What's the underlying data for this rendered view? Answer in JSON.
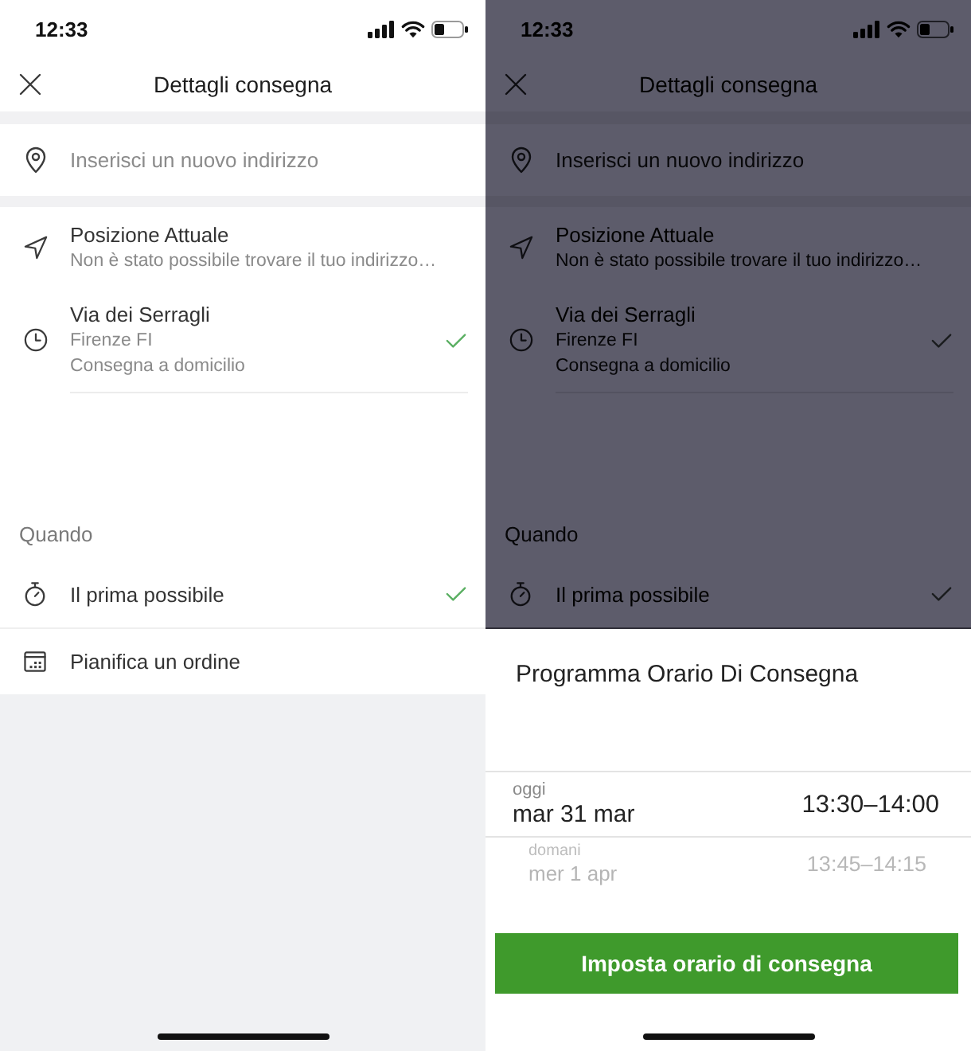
{
  "screens": [
    {
      "dimmed": false,
      "status_bar": {
        "time": "12:33"
      },
      "header": {
        "title": "Dettagli consegna"
      },
      "address_field": {
        "placeholder": "Inserisci un nuovo indirizzo"
      },
      "places": [
        {
          "kind": "current_location",
          "title": "Posizione Attuale",
          "lines": [
            "Non è stato possibile trovare il tuo indirizzo…"
          ],
          "selected": false
        },
        {
          "kind": "recent",
          "title": "Via dei Serragli",
          "lines": [
            "Firenze FI",
            "Consegna a domicilio"
          ],
          "selected": true
        }
      ],
      "when": {
        "label": "Quando",
        "options": [
          {
            "kind": "asap",
            "label": "Il prima possibile",
            "selected": true
          },
          {
            "kind": "schedule",
            "label": "Pianifica un ordine",
            "selected": false
          }
        ]
      }
    },
    {
      "dimmed": true,
      "status_bar": {
        "time": "12:33"
      },
      "header": {
        "title": "Dettagli consegna"
      },
      "address_field": {
        "placeholder": "Inserisci un nuovo indirizzo"
      },
      "places": [
        {
          "kind": "current_location",
          "title": "Posizione Attuale",
          "lines": [
            "Non è stato possibile trovare il tuo indirizzo…"
          ],
          "selected": false
        },
        {
          "kind": "recent",
          "title": "Via dei Serragli",
          "lines": [
            "Firenze FI",
            "Consegna a domicilio"
          ],
          "selected": true
        }
      ],
      "when": {
        "label": "Quando",
        "options": [
          {
            "kind": "asap",
            "label": "Il prima possibile",
            "selected": true
          }
        ]
      },
      "sheet": {
        "title": "Programma Orario Di Consegna",
        "slots": [
          {
            "day": "oggi",
            "date": "mar 31 mar",
            "time": "13:30–14:00",
            "selected": true
          },
          {
            "day": "domani",
            "date": "mer 1 apr",
            "time": "13:45–14:15",
            "selected": false
          }
        ],
        "button": "Imposta orario di consegna"
      }
    }
  ]
}
